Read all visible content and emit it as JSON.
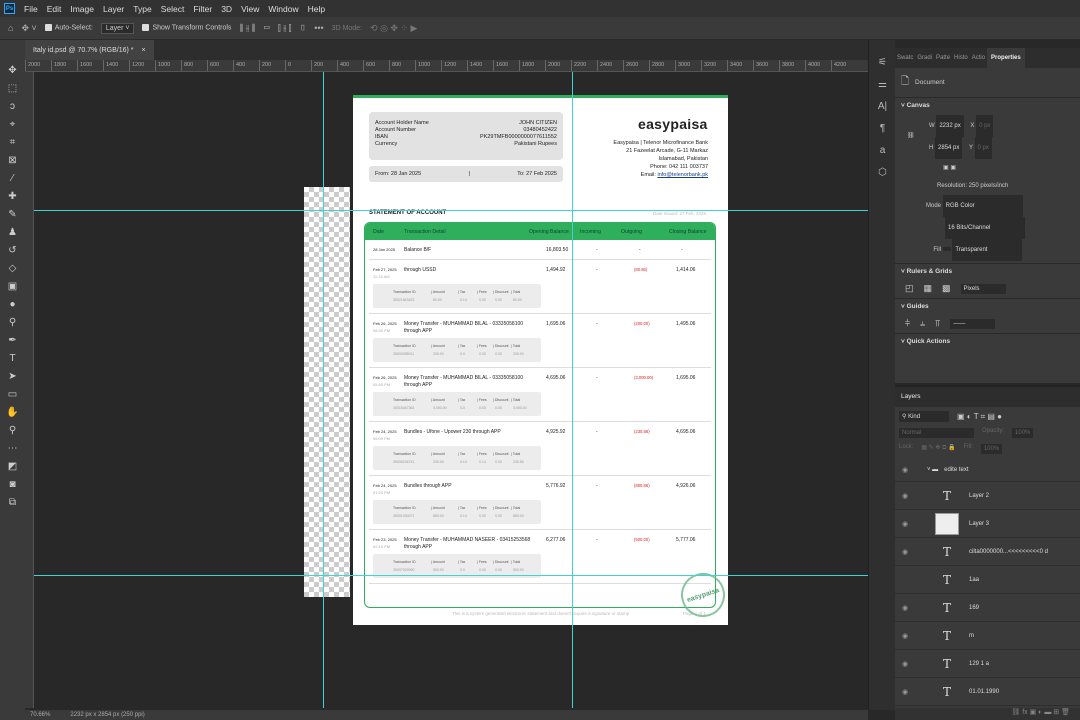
{
  "menu": [
    "File",
    "Edit",
    "Image",
    "Layer",
    "Type",
    "Select",
    "Filter",
    "3D",
    "View",
    "Window",
    "Help"
  ],
  "options": {
    "auto_select": "Auto-Select:",
    "layer": "Layer",
    "show_transform": "Show Transform Controls",
    "mode3d": "3D Mode:"
  },
  "doc_tab": "Italy id.psd @ 70.7% (RGB/16) *",
  "ruler": [
    "2000",
    "1800",
    "1600",
    "1400",
    "1200",
    "1000",
    "800",
    "600",
    "400",
    "200",
    "0",
    "200",
    "400",
    "600",
    "800",
    "1000",
    "1200",
    "1400",
    "1600",
    "1800",
    "2000",
    "2200",
    "2400",
    "2600",
    "2800",
    "3000",
    "3200",
    "3400",
    "3600",
    "3800",
    "4000",
    "4200"
  ],
  "statement": {
    "info": [
      [
        "Account Holder Name",
        "JOHN CITIZEN"
      ],
      [
        "Account Number",
        "03480452422"
      ],
      [
        "IBAN",
        "PK29TMFB0000000077611552"
      ],
      [
        "Currency",
        "Pakistani Rupees"
      ]
    ],
    "from": "From: 28 Jan 2025",
    "sep": "|",
    "to": "To: 27 Feb 2025",
    "logo": "easypaisa",
    "address": [
      "Easypaisa | Telenor Microfinance Bank",
      "21 Fazeelat Arcade, G-11 Markaz",
      "Islamabad, Pakistan",
      "Phone: 042 111 003737"
    ],
    "email_label": "Email: ",
    "email": "info@telenorbank.pk",
    "title": "STATEMENT OF ACCOUNT",
    "issued": "Date Issued: 27 Feb, 2025",
    "headers": [
      "Date",
      "Transaction Detail",
      "Opening Balance",
      "Incoming",
      "Outgoing",
      "Closing Balance"
    ],
    "bf": {
      "date": "28 Jan 2025",
      "detail": "Balance B/F",
      "opening": "16,803.50",
      "incoming": "-",
      "outgoing": "-",
      "closing": "-"
    },
    "sub_headers": [
      "Transaction ID",
      "| Amount",
      "| Tax",
      "| Fees",
      "| Discount",
      "| Total"
    ],
    "transactions": [
      {
        "date": "Feb 27, 2025",
        "time": "11:15 AM",
        "detail": "through USSD",
        "opening": "1,494.92",
        "incoming": "-",
        "outgoing": "(80.86)",
        "closing": "1,414.06",
        "sub": [
          "35021843422",
          "80.00",
          "0.14",
          "0.00",
          "0.00",
          "80.00"
        ]
      },
      {
        "date": "Feb 26, 2025",
        "time": "06:30 PM",
        "detail": "Money Transfer - MUHAMMAD BILAL - 03335058100 through APP",
        "opening": "1,695.06",
        "incoming": "-",
        "outgoing": "(200.00)",
        "closing": "1,495.06",
        "sub": [
          "35000058011",
          "200.00",
          "0.0",
          "0.00",
          "0.00",
          "200.00"
        ]
      },
      {
        "date": "Feb 26, 2025",
        "time": "05:40 PM",
        "detail": "Money Transfer - MUHAMMAD BILAL - 03335058100 through APP",
        "opening": "4,695.06",
        "incoming": "-",
        "outgoing": "(3,000.00)",
        "closing": "1,695.06",
        "sub": [
          "35016447361",
          "3,000.00",
          "0.0",
          "0.00",
          "0.00",
          "3,000.00"
        ]
      },
      {
        "date": "Feb 24, 2025",
        "time": "05:09 PM",
        "detail": "Bundles - Ufone - Upower 230 through APP",
        "opening": "4,925.92",
        "incoming": "-",
        "outgoing": "(230.86)",
        "closing": "4,695.06",
        "sub": [
          "35006236741",
          "230.00",
          "0.14",
          "0.14",
          "0.00",
          "230.86"
        ]
      },
      {
        "date": "Feb 24, 2025",
        "time": "01:20 PM",
        "detail": "Bundles through APP",
        "opening": "5,776.92",
        "incoming": "-",
        "outgoing": "(850.86)",
        "closing": "4,926.06",
        "sub": [
          "35001030071",
          "850.00",
          "0.14",
          "0.00",
          "0.00",
          "850.00"
        ]
      },
      {
        "date": "Feb 23, 2025",
        "time": "02:15 PM",
        "detail": "Money Transfer - MUHAMMAD NASEER - 03415253568 through APP",
        "opening": "6,277.06",
        "incoming": "-",
        "outgoing": "(500.00)",
        "closing": "5,777.06",
        "sub": [
          "35007029090",
          "500.00",
          "0.0",
          "0.00",
          "0.00",
          "500.00"
        ]
      }
    ],
    "footer": "This is a system generated electronic statement and doesn't require a signature or stamp",
    "page": "Page 1 of 1"
  },
  "properties": {
    "tabs": [
      "Swatc",
      "Gradi",
      "Patte",
      "Histo",
      "Actio",
      "Properties"
    ],
    "doc": "Document",
    "canvas": "Canvas",
    "w_label": "W",
    "w": "2232 px",
    "h_label": "H",
    "h": "2854 px",
    "x_label": "X",
    "x": "0 px",
    "y_label": "Y",
    "y": "0 px",
    "resolution": "Resolution: 250 pixels/inch",
    "mode_label": "Mode",
    "mode": "RGB Color",
    "depth": "16 Bits/Channel",
    "fill_label": "Fill",
    "fill": "Transparent",
    "rulers": "Rulers & Grids",
    "units": "Pixels",
    "guides": "Guides",
    "quick": "Quick Actions"
  },
  "layers": {
    "title": "Layers",
    "kind": "Kind",
    "blend": "Normal",
    "opacity_label": "Opacity:",
    "opacity": "100%",
    "lock": "Lock:",
    "fill_label": "Fill:",
    "fill": "100%",
    "group": "edite text",
    "items": [
      {
        "name": "Layer 2",
        "type": "T"
      },
      {
        "name": "Layer 3",
        "type": "img"
      },
      {
        "name": "cilta0000000...<<<<<<<<<0 d",
        "type": "T"
      },
      {
        "name": "1aa",
        "type": "T"
      },
      {
        "name": "169",
        "type": "T"
      },
      {
        "name": "m",
        "type": "T"
      },
      {
        "name": "129 1 a",
        "type": "T"
      },
      {
        "name": "01.01.1990",
        "type": "T"
      }
    ]
  },
  "status": {
    "zoom": "70.66%",
    "size": "2232 px x 2854 px (250 ppi)"
  },
  "colors": {
    "brand": "#2fae5b",
    "guide": "#3fd3d3",
    "negative": "#dd2222"
  }
}
